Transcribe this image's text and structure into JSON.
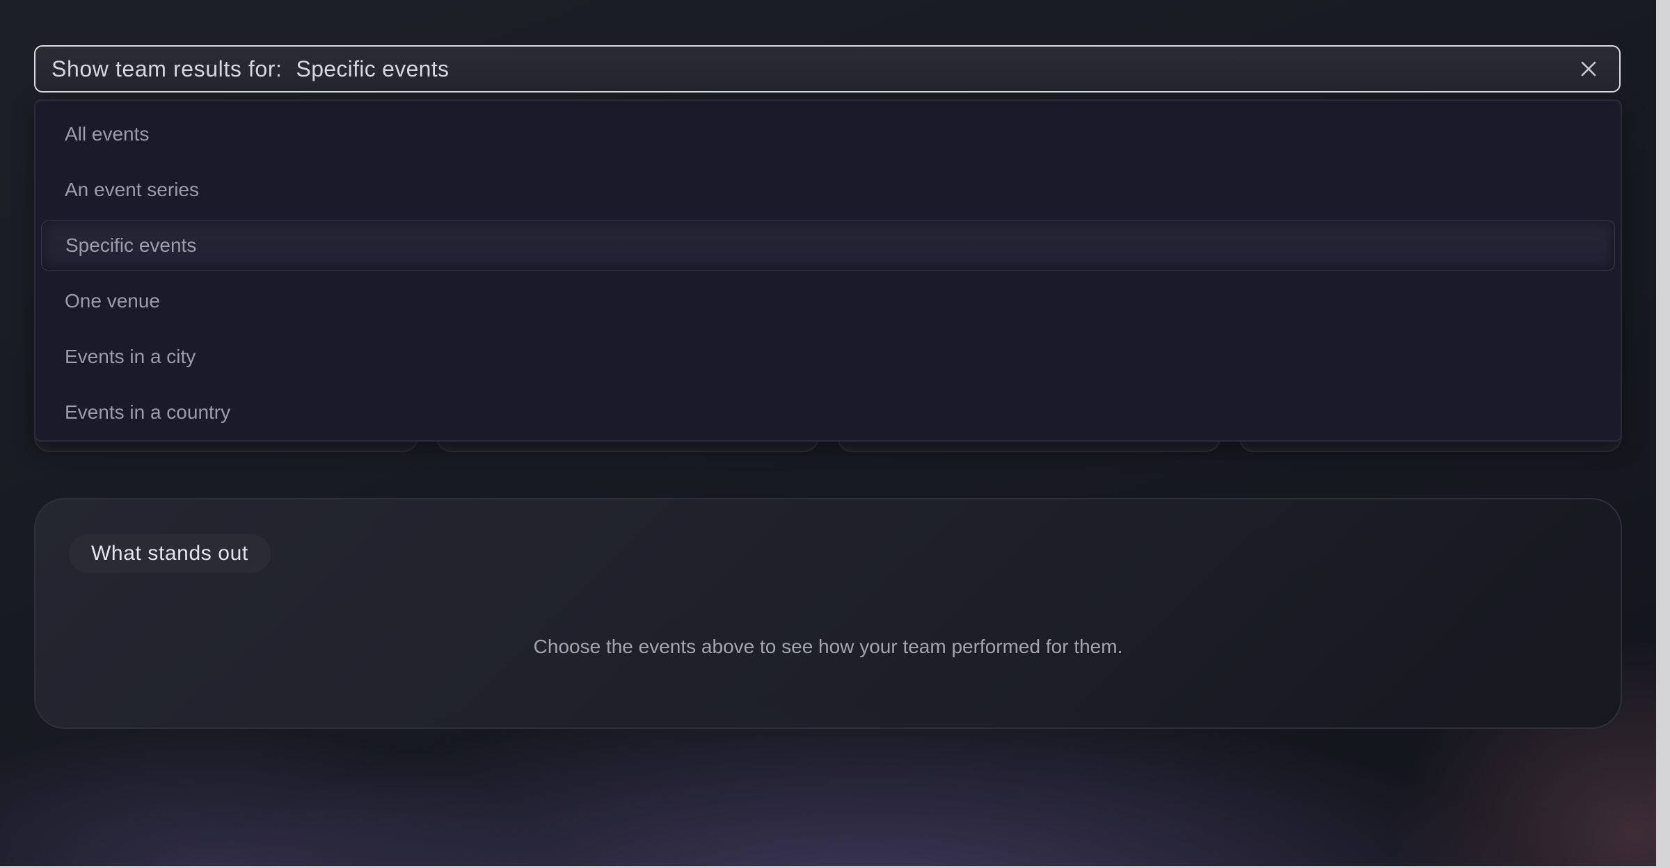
{
  "selector": {
    "prefix": "Show team results for:",
    "value": "Specific events",
    "clear_icon": "close-icon"
  },
  "dropdown": {
    "options": [
      {
        "label": "All events",
        "selected": false
      },
      {
        "label": "An event series",
        "selected": false
      },
      {
        "label": "Specific events",
        "selected": true
      },
      {
        "label": "One venue",
        "selected": false
      },
      {
        "label": "Events in a city",
        "selected": false
      },
      {
        "label": "Events in a country",
        "selected": false
      }
    ]
  },
  "insights": {
    "title": "What stands out",
    "empty_message": "Choose the events above to see how your team performed for them."
  },
  "colors": {
    "background": "#181a23",
    "dropdown_bg": "#1b1a2b",
    "selector_border": "#dcdce4",
    "text_muted": "#9d9cad"
  }
}
